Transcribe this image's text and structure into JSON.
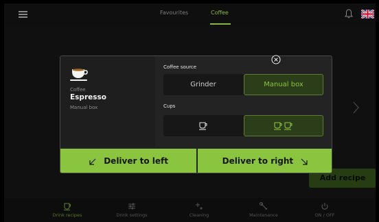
{
  "header": {
    "tabs": [
      {
        "label": "Favourites",
        "active": false
      },
      {
        "label": "Coffee",
        "active": true
      }
    ]
  },
  "colors": {
    "accent": "#8bc43e",
    "accent_dark": "#2c3d1a"
  },
  "background": {
    "add_recipe_label": "Add recipe"
  },
  "modal": {
    "drink": {
      "category": "Coffee",
      "name": "Espresso",
      "source": "Manual box",
      "icon": "espresso-cup-icon"
    },
    "coffee_source": {
      "label": "Coffee source",
      "options": [
        "Grinder",
        "Manual box"
      ],
      "selected": "Manual box"
    },
    "cups": {
      "label": "Cups",
      "options": [
        "single-cup-icon",
        "double-cup-icon"
      ],
      "selected": "double-cup-icon"
    },
    "actions": {
      "deliver_left": "Deliver to left",
      "deliver_right": "Deliver to right"
    }
  },
  "bottom_nav": [
    {
      "label": "Drink recipes",
      "icon": "drink-recipes-icon",
      "active": true
    },
    {
      "label": "Drink settings",
      "icon": "sliders-icon",
      "active": false
    },
    {
      "label": "Cleaning",
      "icon": "sparkle-icon",
      "active": false
    },
    {
      "label": "Maintenance",
      "icon": "wrench-icon",
      "active": false
    },
    {
      "label": "ON / OFF",
      "icon": "power-icon",
      "active": false
    }
  ]
}
